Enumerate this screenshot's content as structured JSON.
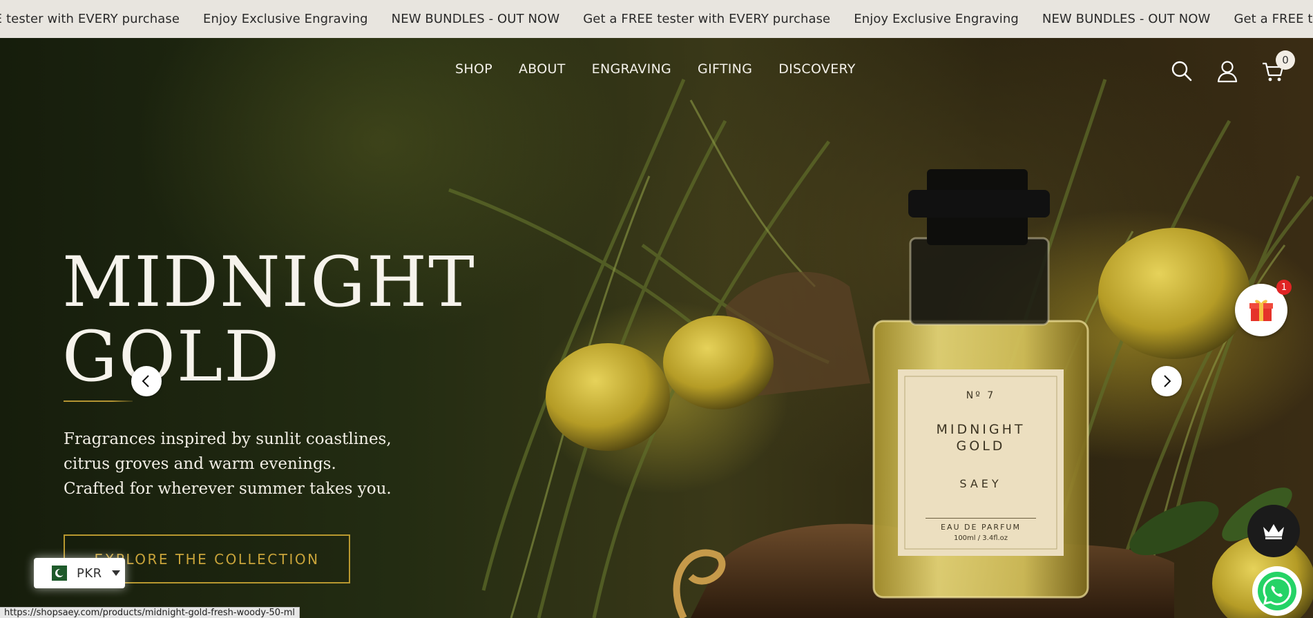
{
  "announcement": {
    "items": [
      "Get a FREE tester with EVERY purchase",
      "Enjoy Exclusive Engraving",
      "NEW BUNDLES - OUT NOW",
      "Get a FREE tester with EVERY purchase",
      "Enjoy Exclusive Engraving",
      "NEW BUNDLES - OUT NOW",
      "Get a FREE tester with EVERY purchase"
    ]
  },
  "nav": {
    "items": [
      "SHOP",
      "ABOUT",
      "ENGRAVING",
      "GIFTING",
      "DISCOVERY"
    ]
  },
  "header": {
    "icons": [
      "search-icon",
      "account-icon",
      "cart-icon"
    ],
    "cart_count": "0"
  },
  "hero": {
    "title_line1": "MIDNIGHT",
    "title_line2": "GOLD",
    "description_line1": "Fragrances inspired by sunlit coastlines,",
    "description_line2": "citrus groves and warm evenings.",
    "description_line3": "Crafted for wherever summer takes you.",
    "cta_label": "EXPLORE THE COLLECTION",
    "accent_color": "#b8982f",
    "product_label": {
      "number": "Nº 7",
      "name_line1": "MIDNIGHT",
      "name_line2": "GOLD",
      "brand": "SAEY",
      "type": "EAU DE PARFUM",
      "volume": "100ml / 3.4fl.oz"
    }
  },
  "carousel": {
    "prev_icon": "chevron-left-icon",
    "next_icon": "chevron-right-icon"
  },
  "widgets": {
    "gift_badge": "1",
    "gift_icon": "gift-icon",
    "rewards_icon": "crown-icon",
    "chat_icon": "whatsapp-icon"
  },
  "currency": {
    "code": "PKR",
    "flag": "pakistan-flag-icon"
  },
  "status_bar": {
    "url": "https://shopsaey.com/products/midnight-gold-fresh-woody-50-ml"
  }
}
